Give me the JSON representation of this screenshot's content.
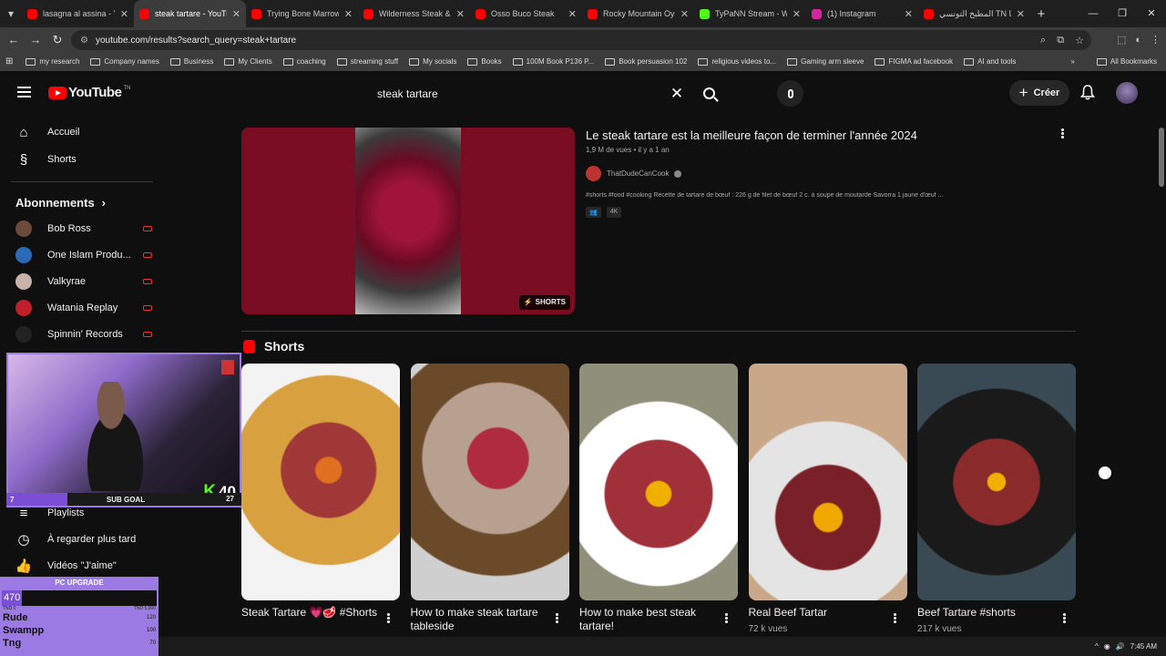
{
  "browser": {
    "tabs": [
      {
        "title": "lasagna al assina - Y",
        "fav": "#ff0000"
      },
      {
        "title": "steak tartare - YouTub",
        "fav": "#ff0000",
        "active": true
      },
      {
        "title": "Trying Bone Marrow",
        "fav": "#ff0000"
      },
      {
        "title": "Wilderness Steak & T",
        "fav": "#ff0000"
      },
      {
        "title": "Osso Buco Steak",
        "fav": "#ff0000"
      },
      {
        "title": "Rocky Mountain Oys",
        "fav": "#ff0000"
      },
      {
        "title": "TyPaNN Stream - We",
        "fav": "#53fc18"
      },
      {
        "title": "(1) Instagram",
        "fav": "#d6249f"
      },
      {
        "title": "المطبخ التونسي TN قنا",
        "fav": "#ff0000"
      }
    ],
    "url": "youtube.com/results?search_query=steak+tartare",
    "bookmarks": [
      "my research",
      "Company names",
      "Business",
      "My Clients",
      "coaching",
      "streaming stuff",
      "My socials",
      "Books",
      "100M Book P136 P...",
      "Book persuasion 102",
      "religious videos to...",
      "Gaming arm sleeve",
      "FIGMA ad facebook",
      "AI and tools"
    ],
    "all_bookmarks": "All Bookmarks"
  },
  "header": {
    "logo": "YouTube",
    "country": "TN",
    "search_query": "steak tartare",
    "create_label": "Créer"
  },
  "sidebar": {
    "home": "Accueil",
    "shorts": "Shorts",
    "subscriptions_heading": "Abonnements",
    "subscriptions": [
      {
        "name": "Bob Ross",
        "color": "#6b4a3a"
      },
      {
        "name": "One Islam Produ...",
        "color": "#2a6bb8"
      },
      {
        "name": "Valkyrae",
        "color": "#c7b3a8"
      },
      {
        "name": "Watania Replay",
        "color": "#c0202a"
      },
      {
        "name": "Spinnin' Records",
        "color": "#222222"
      }
    ],
    "playlists": "Playlists",
    "watch_later": "À regarder plus tard",
    "liked": "Vidéos \"J'aime\""
  },
  "stream_overlay": {
    "kick_count": "40",
    "subgoal_label": "SUB GOAL",
    "subgoal_current": "7",
    "subgoal_target": "27",
    "subgoal_progress": 0.26,
    "pc_upgrade_title": "PC UPGRADE",
    "pc_upgrade_value": "470",
    "pc_upgrade_min": "TND 0",
    "pc_upgrade_max": "TND 5,000",
    "leaderboard": [
      {
        "name": "Rude",
        "amount": "120"
      },
      {
        "name": "Swampp",
        "amount": "100"
      },
      {
        "name": "Tng",
        "amount": "70"
      }
    ]
  },
  "featured": {
    "title": "Le steak tartare est la meilleure façon de terminer l'année 2024",
    "meta": "1,9 M de vues • il y a 1 an",
    "channel": "ThatDudeCanCook",
    "description": "#shorts #food #cooking Recette de tartare de bœuf : 226 g de filet de bœuf 2 c. à soupe de moutarde Savorra 1 jaune d'œuf ...",
    "badge": "4K",
    "shorts_tag": "SHORTS"
  },
  "shorts_section": {
    "heading": "Shorts",
    "items": [
      {
        "title": "Steak Tartare 💗🥩 #Shorts",
        "views": ""
      },
      {
        "title": "How to make steak tartare tableside",
        "views": ""
      },
      {
        "title": "How to make best steak tartare!",
        "views": ""
      },
      {
        "title": "Real Beef Tartar",
        "views": "72 k vues"
      },
      {
        "title": "Beef Tartare #shorts",
        "views": "217 k vues"
      }
    ]
  },
  "taskbar": {
    "time": "7:45 AM"
  }
}
